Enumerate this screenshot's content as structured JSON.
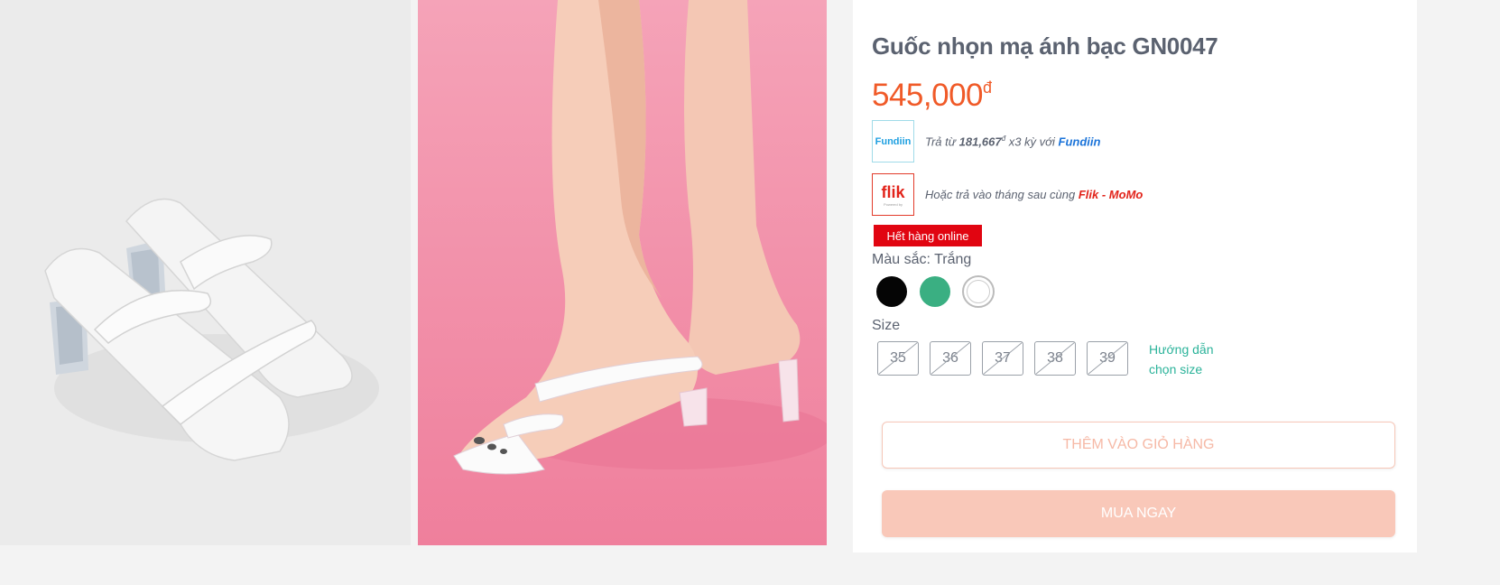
{
  "product": {
    "title": "Guốc nhọn mạ ánh bạc GN0047",
    "price": "545,000",
    "currency": "đ"
  },
  "payments": {
    "fundiin": {
      "logo_text": "Fundiin",
      "prefix": "Trả từ",
      "amount": "181,667",
      "currency": "đ",
      "middle": "x3 kỳ với",
      "brand": "Fundiin"
    },
    "flik": {
      "logo_text": "flik",
      "logo_sub": "Powered by",
      "text": "Hoặc trả vào tháng sau cùng",
      "brand": "Flik - MoMo"
    }
  },
  "stock_badge": "Hết hàng online",
  "color": {
    "label": "Màu sắc: Trắng",
    "options": [
      {
        "name": "black",
        "hex": "#050505",
        "selected": false
      },
      {
        "name": "green",
        "hex": "#3aaf82",
        "selected": false
      },
      {
        "name": "white",
        "hex": "#ffffff",
        "selected": true
      }
    ]
  },
  "size": {
    "label": "Size",
    "options": [
      "35",
      "36",
      "37",
      "38",
      "39"
    ],
    "guide_line1": "Hướng dẫn",
    "guide_line2": "chọn size"
  },
  "actions": {
    "add_to_cart": "THÊM VÀO GIỎ HÀNG",
    "buy_now": "MUA NGAY"
  },
  "colors": {
    "price": "#f05a28",
    "accent_teal": "#2bb39a",
    "out_of_stock": "#e10511"
  }
}
